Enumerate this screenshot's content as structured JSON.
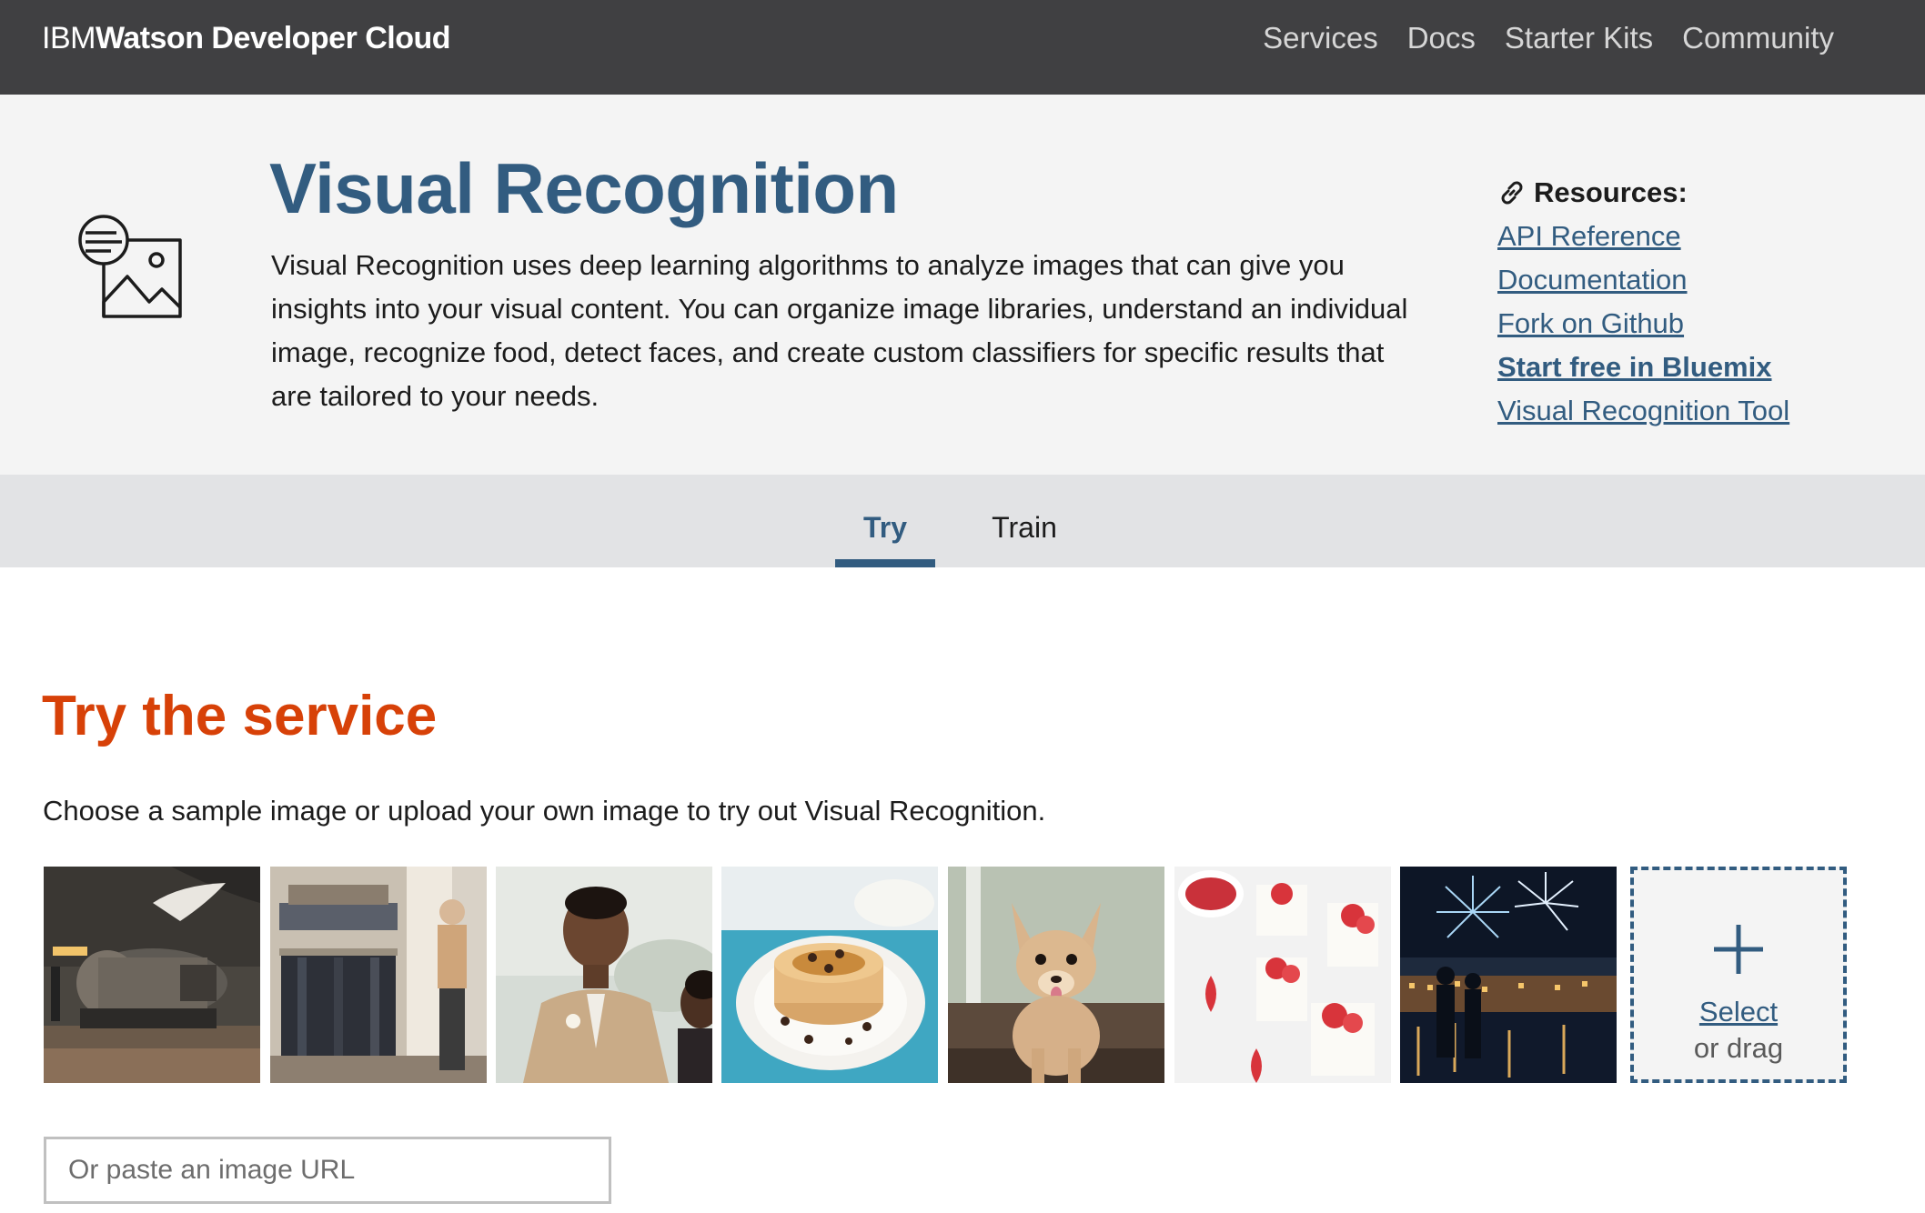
{
  "header": {
    "brand_prefix": "IBM",
    "brand_name": "Watson Developer Cloud",
    "nav": [
      "Services",
      "Docs",
      "Starter Kits",
      "Community"
    ]
  },
  "hero": {
    "icon": "image-recognition-icon",
    "title": "Visual Recognition",
    "description": "Visual Recognition uses deep learning algorithms to analyze images that can give you insights into your visual content. You can organize image libraries, understand an individual image, recognize food, detect faces, and create custom classifiers for specific results that are tailored to your needs."
  },
  "resources": {
    "icon": "link-icon",
    "heading": "Resources:",
    "links": [
      "API Reference",
      "Documentation",
      "Fork on Github",
      "Start free in Bluemix",
      "Visual Recognition Tool"
    ]
  },
  "tabs": {
    "items": [
      "Try",
      "Train"
    ],
    "active": "Try"
  },
  "try_section": {
    "title": "Try the service",
    "description": "Choose a sample image or upload your own image to try out Visual Recognition.",
    "samples": [
      "jet-engine",
      "clothing-store",
      "couple-portrait",
      "pancakes",
      "chihuahua-dog",
      "strawberry-desserts",
      "fireworks-harbor"
    ],
    "upload": {
      "icon": "plus-icon",
      "select_label": "Select",
      "drag_label": "or drag"
    },
    "url_placeholder": "Or paste an image URL"
  },
  "colors": {
    "nav_bg": "#404042",
    "hero_bg": "#f4f4f4",
    "accent_blue": "#325c80",
    "accent_orange": "#d74108",
    "tab_bar_bg": "#e2e3e5"
  }
}
